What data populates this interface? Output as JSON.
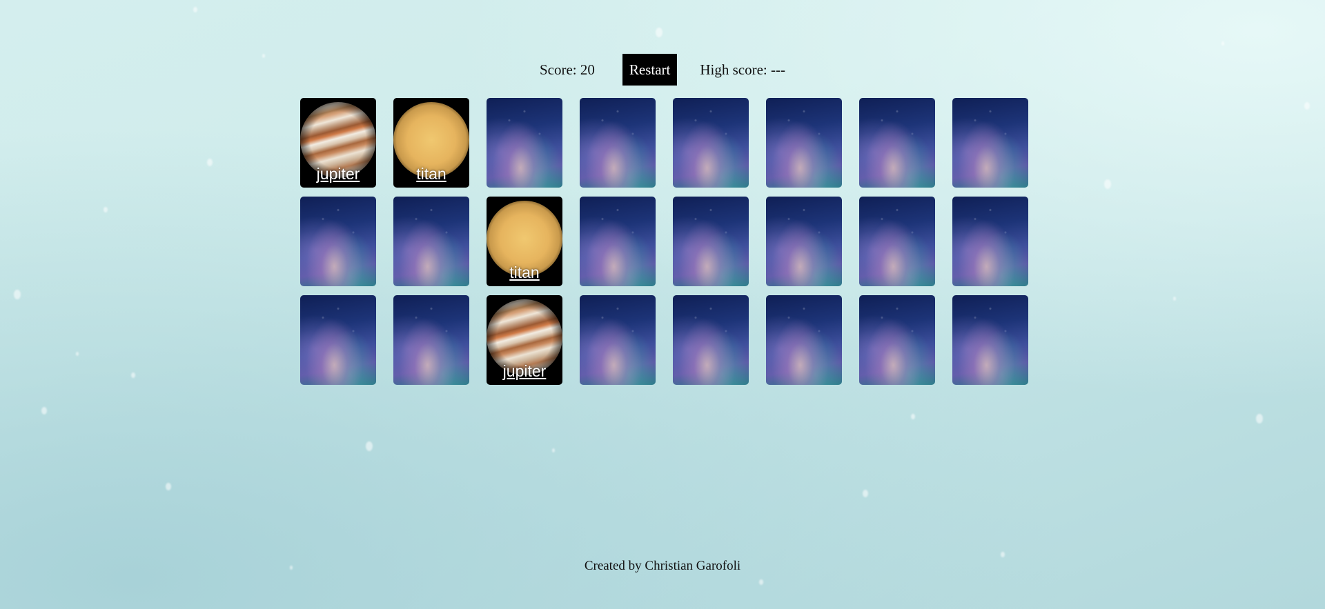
{
  "header": {
    "score_label": "Score: 20",
    "restart_label": "Restart",
    "high_score_label": "High score: ---"
  },
  "board": {
    "rows": 3,
    "columns": 8,
    "cards": [
      {
        "state": "face",
        "planet": "jupiter",
        "label": "jupiter"
      },
      {
        "state": "face",
        "planet": "titan",
        "label": "titan"
      },
      {
        "state": "back"
      },
      {
        "state": "back"
      },
      {
        "state": "back"
      },
      {
        "state": "back"
      },
      {
        "state": "back"
      },
      {
        "state": "back"
      },
      {
        "state": "back"
      },
      {
        "state": "back"
      },
      {
        "state": "face",
        "planet": "titan",
        "label": "titan"
      },
      {
        "state": "back"
      },
      {
        "state": "back"
      },
      {
        "state": "back"
      },
      {
        "state": "back"
      },
      {
        "state": "back"
      },
      {
        "state": "back"
      },
      {
        "state": "back"
      },
      {
        "state": "face",
        "planet": "jupiter",
        "label": "jupiter"
      },
      {
        "state": "back"
      },
      {
        "state": "back"
      },
      {
        "state": "back"
      },
      {
        "state": "back"
      },
      {
        "state": "back"
      }
    ]
  },
  "footer": {
    "credit": "Created by Christian Garofoli"
  }
}
